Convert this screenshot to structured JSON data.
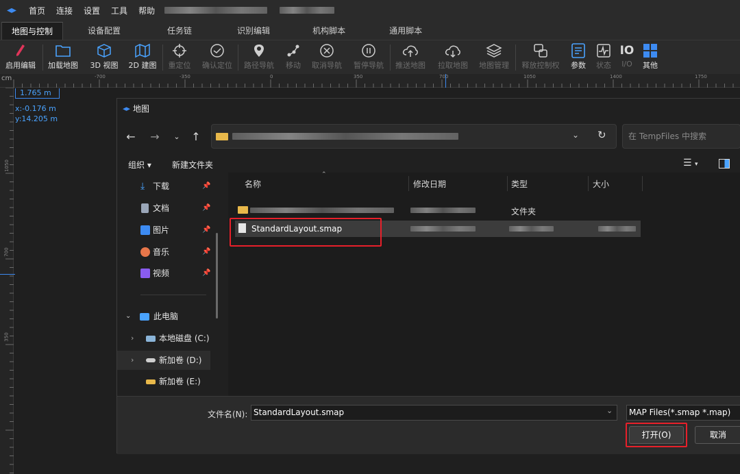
{
  "app": {
    "menu": [
      "首页",
      "连接",
      "设置",
      "工具",
      "帮助"
    ],
    "tabs": [
      "地图与控制",
      "设备配置",
      "任务链",
      "识别编辑",
      "机构脚本",
      "通用脚本"
    ],
    "active_tab": 0,
    "toolbar": [
      {
        "label": "启用编辑",
        "icon": "edit-pen-icon",
        "enabled": true
      },
      {
        "label": "加载地图",
        "icon": "folder-icon",
        "enabled": true
      },
      {
        "label": "3D 视图",
        "icon": "cube-icon",
        "enabled": true
      },
      {
        "label": "2D 建图",
        "icon": "map-icon",
        "enabled": true
      },
      {
        "label": "重定位",
        "icon": "crosshair-icon",
        "enabled": false
      },
      {
        "label": "确认定位",
        "icon": "check-circle-icon",
        "enabled": false
      },
      {
        "label": "路径导航",
        "icon": "location-pin-icon",
        "enabled": false
      },
      {
        "label": "移动",
        "icon": "move-icon",
        "enabled": false
      },
      {
        "label": "取消导航",
        "icon": "cancel-circle-icon",
        "enabled": false
      },
      {
        "label": "暂停导航",
        "icon": "pause-circle-icon",
        "enabled": false
      },
      {
        "label": "推送地图",
        "icon": "cloud-upload-icon",
        "enabled": false
      },
      {
        "label": "拉取地图",
        "icon": "cloud-download-icon",
        "enabled": false
      },
      {
        "label": "地图管理",
        "icon": "layers-icon",
        "enabled": false
      },
      {
        "label": "释放控制权",
        "icon": "release-control-icon",
        "enabled": false
      },
      {
        "label": "参数",
        "icon": "params-icon",
        "enabled": true
      },
      {
        "label": "状态",
        "icon": "status-icon",
        "enabled": false
      },
      {
        "label": "I/O",
        "icon": "io-icon",
        "enabled": false
      },
      {
        "label": "其他",
        "icon": "grid-icon",
        "enabled": true
      }
    ],
    "ruler_unit": "cm",
    "ruler_ticks": [
      "-700",
      "-350",
      "0",
      "350",
      "700",
      "1050",
      "1400",
      "1750"
    ],
    "ruler_left_ticks": [
      "1050",
      "700",
      "350"
    ],
    "scale_label": "1.765 m",
    "coord_x": "x:-0.176 m",
    "coord_y": "y:14.205 m"
  },
  "dialog": {
    "title": "地图",
    "search_placeholder": "在 TempFiles 中搜索",
    "organize": "组织",
    "new_folder": "新建文件夹",
    "sidebar": {
      "quick": [
        {
          "label": "下载",
          "icon": "download-icon",
          "color": "#4aa3ff"
        },
        {
          "label": "文档",
          "icon": "document-icon",
          "color": "#9aa6b8"
        },
        {
          "label": "图片",
          "icon": "pictures-icon",
          "color": "#3d8bf2"
        },
        {
          "label": "音乐",
          "icon": "music-icon",
          "color": "#e8764a"
        },
        {
          "label": "视频",
          "icon": "video-icon",
          "color": "#8a5cf0"
        }
      ],
      "this_pc": "此电脑",
      "drives": [
        "本地磁盘 (C:)",
        "新加卷 (D:)",
        "新加卷 (E:)"
      ]
    },
    "columns": [
      "名称",
      "修改日期",
      "类型",
      "大小"
    ],
    "rows": [
      {
        "name": "",
        "type": "文件夹",
        "kind": "folder"
      },
      {
        "name": "StandardLayout.smap",
        "type": "",
        "kind": "file",
        "selected": true
      }
    ],
    "filename_label": "文件名(N):",
    "filename_value": "StandardLayout.smap",
    "filter_value": "MAP Files(*.smap *.map)",
    "open_button": "打开(O)",
    "cancel_button": "取消"
  }
}
